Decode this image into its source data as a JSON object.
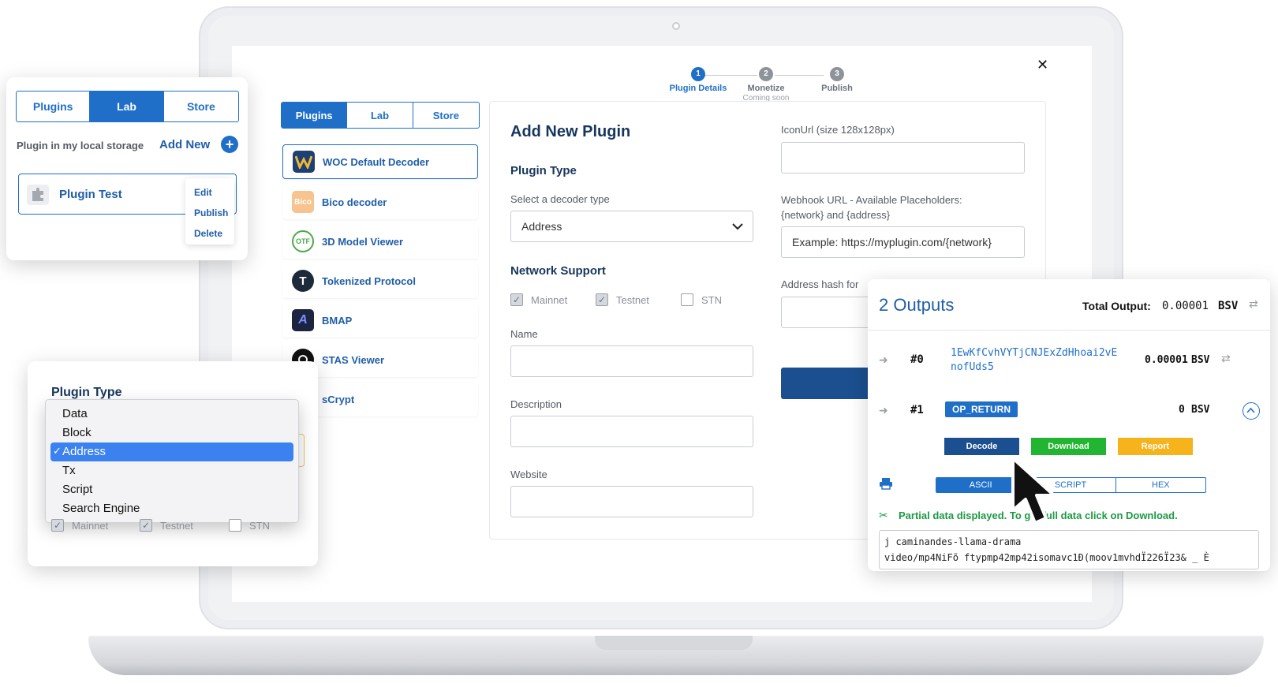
{
  "stepper": [
    {
      "num": "1",
      "label": "Plugin Details",
      "sub": "",
      "active": true
    },
    {
      "num": "2",
      "label": "Monetize",
      "sub": "Coming soon",
      "active": false
    },
    {
      "num": "3",
      "label": "Publish",
      "sub": "",
      "active": false
    }
  ],
  "close_glyph": "✕",
  "main_tabs": [
    "Plugins",
    "Lab",
    "Store"
  ],
  "plugins": [
    {
      "label": "WOC Default Decoder",
      "icon": "woc-logo"
    },
    {
      "label": "Bico decoder",
      "icon": "bico-logo",
      "icon_text": "Bico"
    },
    {
      "label": "3D Model Viewer",
      "icon": "3d-logo",
      "icon_text": "OTF"
    },
    {
      "label": "Tokenized Protocol",
      "icon": "tokenized-logo",
      "icon_text": "T"
    },
    {
      "label": "BMAP",
      "icon": "bmap-logo",
      "icon_text": "A"
    },
    {
      "label": "STAS Viewer",
      "icon": "stas-logo"
    },
    {
      "label": "sCrypt",
      "icon": "scrypt-logo"
    }
  ],
  "form": {
    "title": "Add New Plugin",
    "plugin_type_heading": "Plugin Type",
    "decoder_label": "Select a decoder type",
    "decoder_value": "Address",
    "network_heading": "Network Support",
    "networks": [
      {
        "label": "Mainnet",
        "checked": true
      },
      {
        "label": "Testnet",
        "checked": true
      },
      {
        "label": "STN",
        "checked": false
      }
    ],
    "name_label": "Name",
    "description_label": "Description",
    "website_label": "Website",
    "icon_url_label": "IconUrl (size 128x128px)",
    "webhook_label_1": "Webhook URL - Available Placeholders:",
    "webhook_label_2": "{network} and {address}",
    "webhook_placeholder": "Example: https://myplugin.com/{network}",
    "address_hash_label": "Address hash for"
  },
  "lab_card": {
    "tabs": [
      "Plugins",
      "Lab",
      "Store"
    ],
    "storage_label": "Plugin in my local storage",
    "add_new": "Add New",
    "plugin_name": "Plugin Test",
    "menu": [
      "Edit",
      "Publish",
      "Delete"
    ]
  },
  "type_card": {
    "heading": "Plugin Type",
    "options": [
      "Data",
      "Block",
      "Address",
      "Tx",
      "Script",
      "Search Engine"
    ],
    "selected": "Address",
    "check_glyph": "✓",
    "networks": [
      "Mainnet",
      "Testnet",
      "STN"
    ]
  },
  "outputs": {
    "title": "2 Outputs",
    "total_label": "Total Output:",
    "total_value": "0.00001",
    "total_unit": "BSV",
    "rows": [
      {
        "index": "#0",
        "address_1": "1EwKfCvhVYTjCNJExZdHhoai2vE",
        "address_2": "nofUds5",
        "amount": "0.00001",
        "unit": "BSV"
      },
      {
        "index": "#1",
        "badge": "OP_RETURN",
        "amount": "0",
        "unit": "BSV"
      }
    ],
    "actions": [
      "Decode",
      "Download",
      "Report"
    ],
    "views": [
      "ASCII",
      "SCRIPT",
      "HEX"
    ],
    "partial_notice": "Partial data displayed. To get full data click on Download.",
    "data_line_1": "j caminandes-llama-drama",
    "data_line_2": "video/mp4NiFõ ftypmp42mp42isomavc1Ð(moov1mvhdÏ226Ï23& _ È"
  },
  "colors": {
    "primary": "#1f6fc9",
    "navy": "#17365d",
    "decode": "#1b4f8f",
    "download": "#22b531",
    "report": "#f6b31b",
    "notice": "#1c9a43"
  }
}
